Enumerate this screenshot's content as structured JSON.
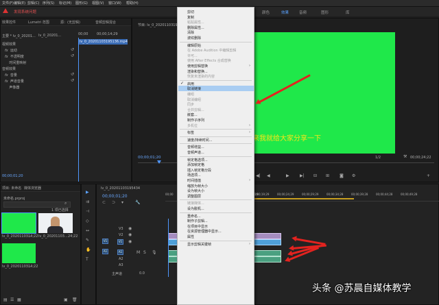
{
  "menubar": {
    "items": [
      "文件(F)",
      "编辑(E)",
      "剪辑(C)",
      "序列(S)",
      "标记(M)",
      "图形(G)",
      "视图(V)",
      "窗口(W)",
      "帮助(H)"
    ]
  },
  "warning": {
    "text": "发现系统问题"
  },
  "workspace_tabs": {
    "items": [
      "颜色",
      "效果",
      "音频",
      "图形",
      "库"
    ],
    "active": "效果"
  },
  "effect_controls": {
    "tabs": [
      "源：(无剪辑)",
      "Lumetri 范围",
      "源：(无剪辑)",
      "音频剪辑混合"
    ],
    "tab0": "效果控件",
    "master_label": "主要 * lv_0_20201...",
    "clip_label": "lv_0_20201...",
    "timecode_start": "00;00",
    "timecode_mark": "00;00;14;29",
    "clip_name": "lv_0_20201103195136.mp4",
    "rows": [
      "运动",
      "不透明度",
      "时间重映射",
      "音量",
      "声道音量",
      "声像器"
    ],
    "section_video": "视频效果",
    "section_audio": "音频效果",
    "time": "00;00;01;20"
  },
  "program": {
    "title": "节目: lv_0_20201103195434",
    "caption": "来我就给大家分享一下",
    "timecode": "00;00;01;20",
    "duration": "00;00;24;22",
    "zoom": "1/2"
  },
  "project": {
    "tabs": [
      "项目: 未命名",
      "媒体浏览器"
    ],
    "path": "未命名.prproj",
    "count": "1 项已选择",
    "items": [
      {
        "name": "lv_0_20201103...",
        "dur": "14;22"
      },
      {
        "name": "lv_0_20201103...",
        "dur": "24;22"
      },
      {
        "name": "lv_0_20201103...",
        "dur": "14;22"
      }
    ]
  },
  "timeline": {
    "title": "lv_0_20201103195434",
    "timecode": "00;00;01;20",
    "ruler": [
      "00;00",
      "00;00;04;29",
      "00;00;09;29",
      "00;00;14;29",
      "00;00;19;29",
      "00;00;24;29",
      "00;00;29;29",
      "00;00;34;28",
      "00;00;39;28",
      "00;00;44;28",
      "00;00;49;28"
    ],
    "tracks": [
      "V3",
      "V2",
      "V1",
      "A1",
      "A2",
      "A3",
      "主声道"
    ],
    "master_val": "0.0"
  },
  "context_menu": {
    "items": [
      {
        "label": "剪切",
        "disabled": false,
        "arrow": false
      },
      {
        "label": "复制",
        "disabled": false,
        "arrow": false
      },
      {
        "label": "粘贴属性...",
        "disabled": true,
        "arrow": false
      },
      {
        "label": "删除属性...",
        "disabled": false,
        "arrow": false
      },
      {
        "label": "清除",
        "disabled": false,
        "arrow": false
      },
      {
        "label": "波纹删除",
        "disabled": false,
        "arrow": false
      },
      {
        "sep": true
      },
      {
        "label": "编辑原始",
        "disabled": false,
        "arrow": false
      },
      {
        "label": "在 Adobe Audition 中编辑剪辑",
        "disabled": true,
        "arrow": false
      },
      {
        "label": "许可...",
        "disabled": true,
        "arrow": false
      },
      {
        "label": "使用 After Effects 合成替换",
        "disabled": true,
        "arrow": false
      },
      {
        "label": "使用剪辑替换",
        "disabled": false,
        "arrow": true
      },
      {
        "label": "渲染和替换...",
        "disabled": false,
        "arrow": false
      },
      {
        "label": "恢复未渲染的内容",
        "disabled": true,
        "arrow": false
      },
      {
        "sep": true
      },
      {
        "label": "启用",
        "disabled": false,
        "arrow": false,
        "check": true
      },
      {
        "label": "取消链接",
        "disabled": false,
        "arrow": false,
        "highlight": true
      },
      {
        "label": "编组",
        "disabled": true,
        "arrow": false
      },
      {
        "label": "取消编组",
        "disabled": true,
        "arrow": false
      },
      {
        "label": "同步",
        "disabled": true,
        "arrow": false
      },
      {
        "label": "合并剪辑...",
        "disabled": true,
        "arrow": false
      },
      {
        "label": "嵌套...",
        "disabled": false,
        "arrow": false
      },
      {
        "label": "制作子序列",
        "disabled": false,
        "arrow": false
      },
      {
        "label": "多机位",
        "disabled": true,
        "arrow": true
      },
      {
        "sep": true
      },
      {
        "label": "标签",
        "disabled": false,
        "arrow": true
      },
      {
        "sep": true
      },
      {
        "label": "速度/持续时间...",
        "disabled": false,
        "arrow": false
      },
      {
        "sep": true
      },
      {
        "label": "音频增益...",
        "disabled": false,
        "arrow": false
      },
      {
        "label": "音频声道...",
        "disabled": false,
        "arrow": false
      },
      {
        "sep": true
      },
      {
        "label": "帧定格选项...",
        "disabled": false,
        "arrow": false
      },
      {
        "label": "添加帧定格",
        "disabled": false,
        "arrow": false
      },
      {
        "label": "插入帧定格分段",
        "disabled": false,
        "arrow": false
      },
      {
        "label": "场选项...",
        "disabled": false,
        "arrow": false
      },
      {
        "label": "时间插值",
        "disabled": false,
        "arrow": true
      },
      {
        "label": "缩放为帧大小",
        "disabled": false,
        "arrow": false
      },
      {
        "label": "设为帧大小",
        "disabled": false,
        "arrow": false
      },
      {
        "label": "调整图层",
        "disabled": false,
        "arrow": false
      },
      {
        "sep": true
      },
      {
        "label": "链接媒体...",
        "disabled": true,
        "arrow": false
      },
      {
        "label": "设为脱机...",
        "disabled": false,
        "arrow": false
      },
      {
        "sep": true
      },
      {
        "label": "重命名...",
        "disabled": false,
        "arrow": false
      },
      {
        "label": "制作子剪辑...",
        "disabled": false,
        "arrow": false
      },
      {
        "label": "在项目中显示",
        "disabled": false,
        "arrow": false
      },
      {
        "label": "在资源管理器中显示...",
        "disabled": false,
        "arrow": false
      },
      {
        "label": "属性",
        "disabled": false,
        "arrow": false
      },
      {
        "sep": true
      },
      {
        "label": "显示剪辑关键帧",
        "disabled": false,
        "arrow": true
      }
    ]
  },
  "watermark": "头条 @苏晨自媒体教学",
  "colors": {
    "green": "#1fe84a",
    "accent": "#4f97ff",
    "arrow": "#e3231f",
    "highlight": "#a9cdf2"
  }
}
